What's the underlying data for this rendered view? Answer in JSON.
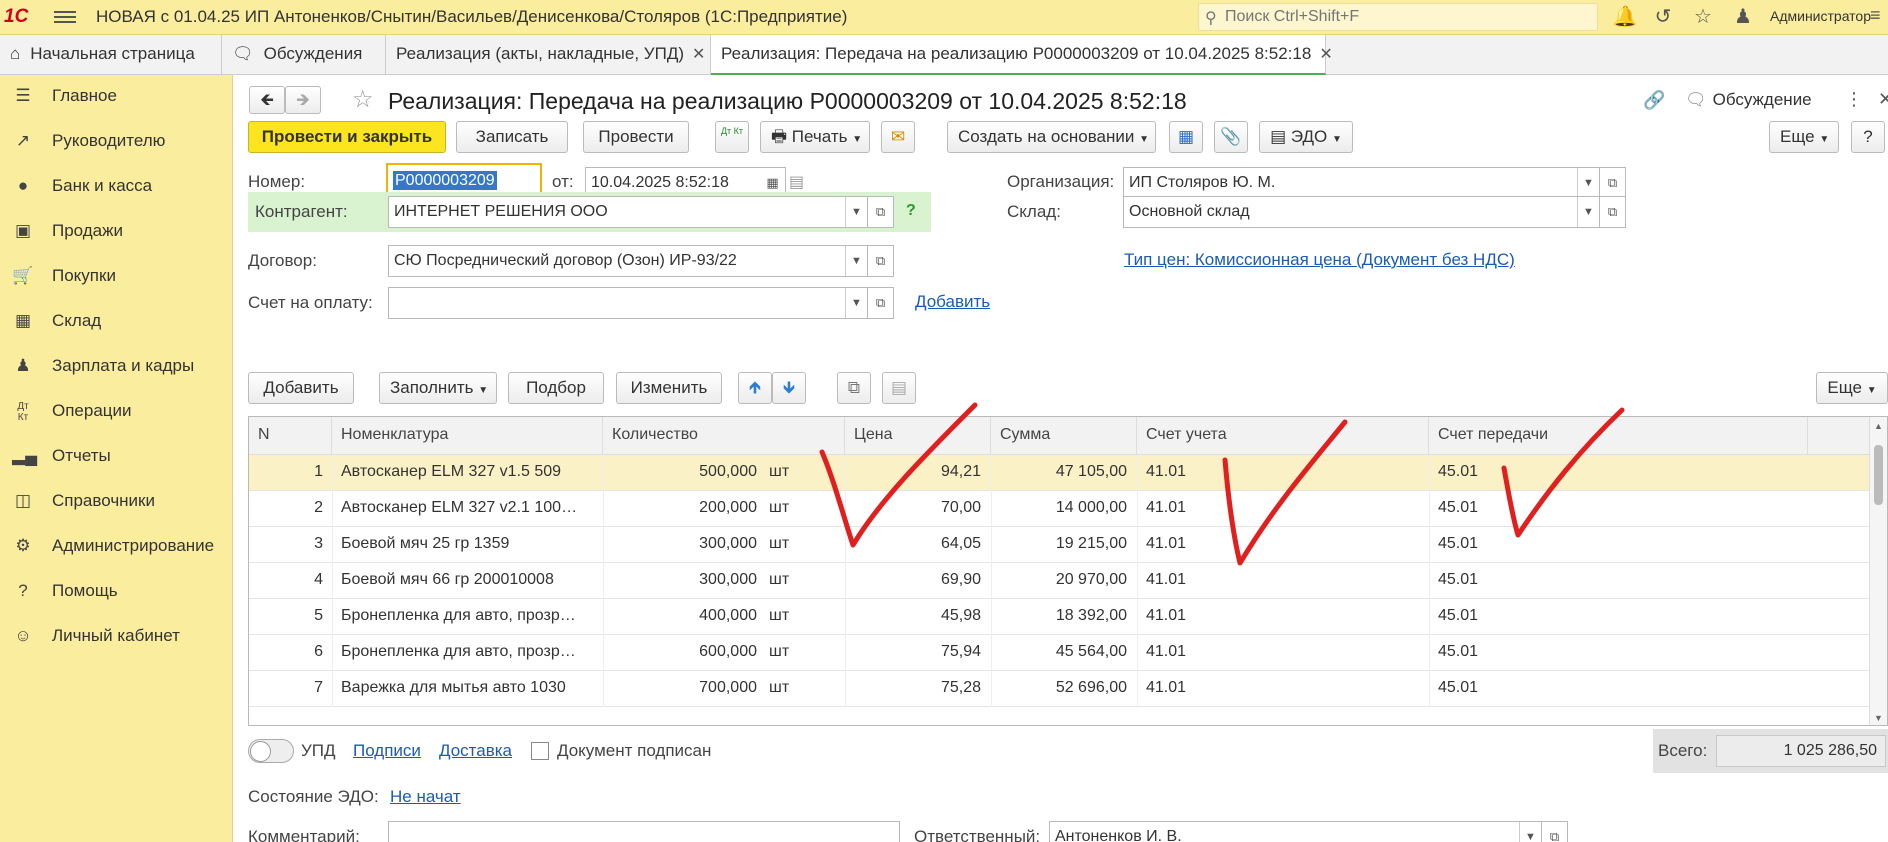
{
  "topbar": {
    "logo": "1С",
    "title": "НОВАЯ с 01.04.25 ИП Антоненков/Снытин/Васильев/Денисенкова/Столяров  (1С:Предприятие)",
    "search_placeholder": "Поиск Ctrl+Shift+F",
    "user": "Администратор"
  },
  "tabs": [
    {
      "label": "Начальная страница"
    },
    {
      "label": "Обсуждения"
    },
    {
      "label": "Реализация (акты, накладные, УПД)"
    },
    {
      "label": "Реализация: Передача на реализацию Р0000003209 от 10.04.2025 8:52:18"
    }
  ],
  "sidebar": {
    "items": [
      {
        "label": "Главное",
        "icon": "menu-lines"
      },
      {
        "label": "Руководителю",
        "icon": "trend"
      },
      {
        "label": "Банк и касса",
        "icon": "coin"
      },
      {
        "label": "Продажи",
        "icon": "bag"
      },
      {
        "label": "Покупки",
        "icon": "cart"
      },
      {
        "label": "Склад",
        "icon": "boxes"
      },
      {
        "label": "Зарплата и кадры",
        "icon": "person"
      },
      {
        "label": "Операции",
        "icon": "dt-kt"
      },
      {
        "label": "Отчеты",
        "icon": "bars"
      },
      {
        "label": "Справочники",
        "icon": "book"
      },
      {
        "label": "Администрирование",
        "icon": "gear"
      },
      {
        "label": "Помощь",
        "icon": "question"
      },
      {
        "label": "Личный кабинет",
        "icon": "user-circle"
      }
    ]
  },
  "form": {
    "title": "Реализация: Передача на реализацию Р0000003209 от 10.04.2025 8:52:18",
    "discuss_label": "Обсуждение",
    "toolbar": {
      "post_close": "Провести и закрыть",
      "save": "Записать",
      "post": "Провести",
      "dtkt": "Дт Кт",
      "print": "Печать",
      "create_based": "Создать на основании",
      "edo": "ЭДО",
      "more": "Еще",
      "help": "?"
    },
    "number_label": "Номер:",
    "number_value": "Р0000003209",
    "from_label": "от:",
    "date_value": "10.04.2025  8:52:18",
    "org_label": "Организация:",
    "org_value": "ИП Столяров Ю. М.",
    "contractor_label": "Контрагент:",
    "contractor_value": "ИНТЕРНЕТ РЕШЕНИЯ ООО",
    "warehouse_label": "Склад:",
    "warehouse_value": "Основной склад",
    "contract_label": "Договор:",
    "contract_value": "СЮ Посреднический договор (Озон) ИР-93/22",
    "price_type_link": "Тип цен: Комиссионная цена (Документ без НДС)",
    "invoice_label": "Счет на оплату:",
    "invoice_value": "",
    "add_link": "Добавить",
    "table_toolbar": {
      "add": "Добавить",
      "fill": "Заполнить",
      "pick": "Подбор",
      "change": "Изменить",
      "more": "Еще"
    }
  },
  "table": {
    "columns": [
      "N",
      "Номенклатура",
      "Количество",
      "Цена",
      "Сумма",
      "Счет учета",
      "Счет передачи"
    ],
    "rows": [
      {
        "n": "1",
        "name": "Автосканер ELM 327 v1.5 509",
        "qty": "500,000",
        "unit": "шт",
        "price": "94,21",
        "sum": "47 105,00",
        "acc": "41.01",
        "acc2": "45.01"
      },
      {
        "n": "2",
        "name": "Автосканер ELM 327 v2.1 100…",
        "qty": "200,000",
        "unit": "шт",
        "price": "70,00",
        "sum": "14 000,00",
        "acc": "41.01",
        "acc2": "45.01"
      },
      {
        "n": "3",
        "name": "Боевой мяч 25 гр 1359",
        "qty": "300,000",
        "unit": "шт",
        "price": "64,05",
        "sum": "19 215,00",
        "acc": "41.01",
        "acc2": "45.01"
      },
      {
        "n": "4",
        "name": "Боевой мяч 66 гр 200010008",
        "qty": "300,000",
        "unit": "шт",
        "price": "69,90",
        "sum": "20 970,00",
        "acc": "41.01",
        "acc2": "45.01"
      },
      {
        "n": "5",
        "name": "Бронепленка для авто, прозр…",
        "qty": "400,000",
        "unit": "шт",
        "price": "45,98",
        "sum": "18 392,00",
        "acc": "41.01",
        "acc2": "45.01"
      },
      {
        "n": "6",
        "name": "Бронепленка для авто, прозр…",
        "qty": "600,000",
        "unit": "шт",
        "price": "75,94",
        "sum": "45 564,00",
        "acc": "41.01",
        "acc2": "45.01"
      },
      {
        "n": "7",
        "name": "Варежка для мытья авто 1030",
        "qty": "700,000",
        "unit": "шт",
        "price": "75,28",
        "sum": "52 696,00",
        "acc": "41.01",
        "acc2": "45.01"
      }
    ]
  },
  "footer": {
    "upd_label": "УПД",
    "signatures_link": "Подписи",
    "delivery_link": "Доставка",
    "signed_label": "Документ подписан",
    "total_label": "Всего:",
    "total_value": "1 025 286,50",
    "edo_state_label": "Состояние ЭДО:",
    "edo_state_link": "Не начат",
    "comment_label": "Комментарий:",
    "responsible_label": "Ответственный:",
    "responsible_value": "Антоненков И. В."
  },
  "colors": {
    "topbar_bg": "#fbed9e",
    "primary_button": "#fce51e",
    "selected_row": "#fbf1c6",
    "check_marks": "#e0201f",
    "link": "#1a5bb5"
  }
}
